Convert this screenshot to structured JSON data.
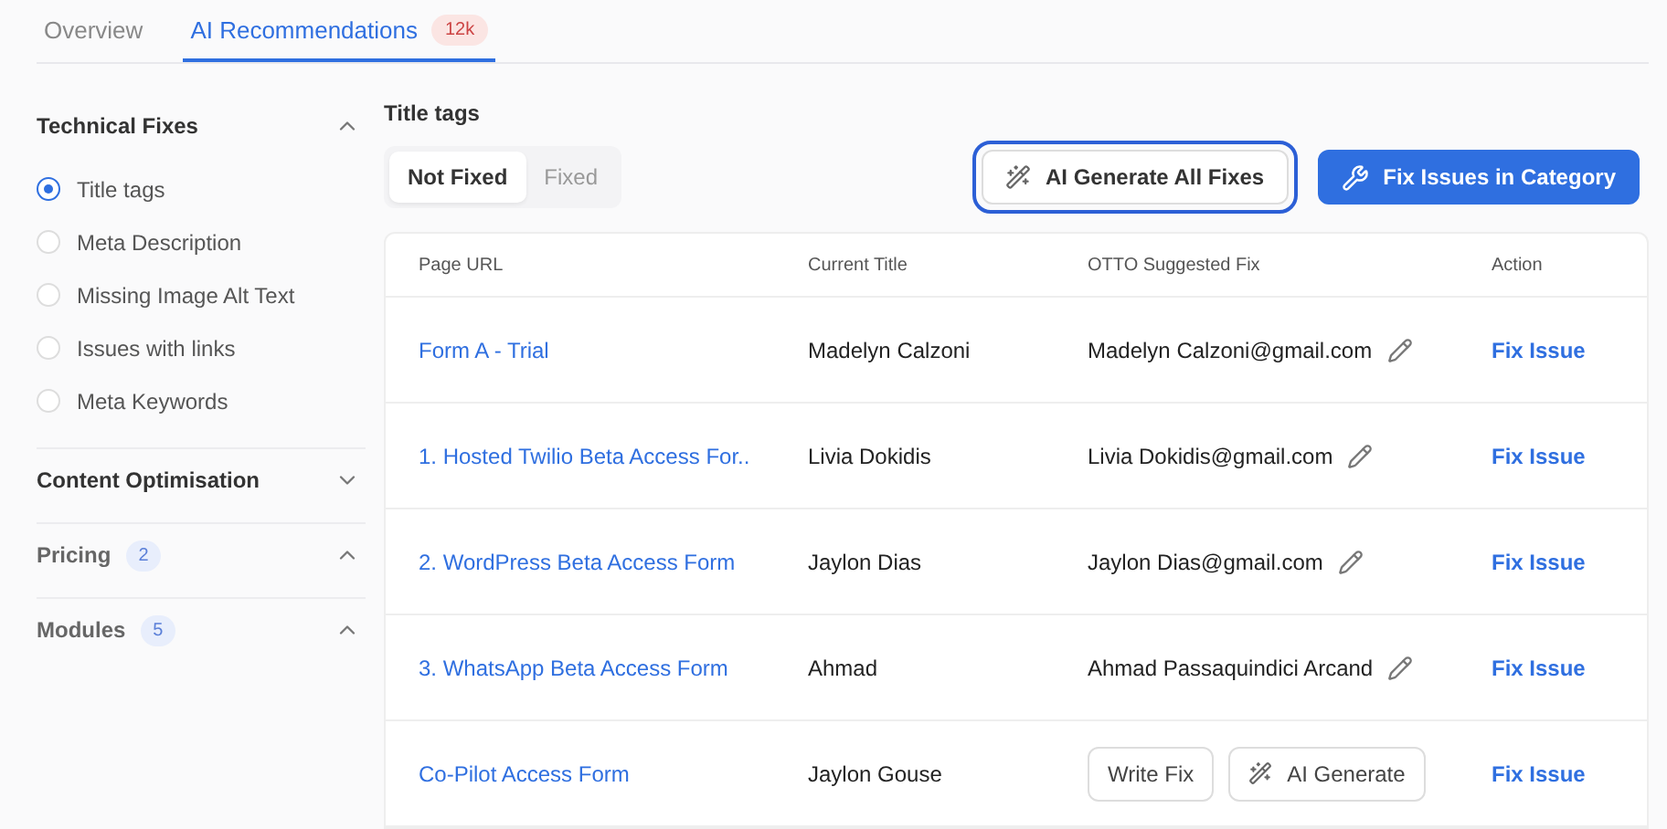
{
  "tabs": [
    {
      "label": "Overview",
      "selected": false
    },
    {
      "label": "AI Recommendations",
      "selected": true,
      "badge": "12k"
    }
  ],
  "sidebar": {
    "sections": [
      {
        "title": "Technical Fixes",
        "expanded": true,
        "items": [
          {
            "label": "Title tags",
            "selected": true
          },
          {
            "label": "Meta Description",
            "selected": false
          },
          {
            "label": "Missing Image Alt Text",
            "selected": false
          },
          {
            "label": "Issues with links",
            "selected": false
          },
          {
            "label": "Meta Keywords",
            "selected": false
          }
        ]
      },
      {
        "title": "Content Optimisation",
        "expanded": false
      },
      {
        "title": "Pricing",
        "count": "2",
        "expanded": true
      },
      {
        "title": "Modules",
        "count": "5",
        "expanded": true
      }
    ]
  },
  "main": {
    "title": "Title tags",
    "filters": [
      {
        "label": "Not Fixed",
        "selected": true
      },
      {
        "label": "Fixed",
        "selected": false
      }
    ],
    "actions": [
      {
        "label": "AI Generate All Fixes",
        "kind": "outline",
        "highlighted": true
      },
      {
        "label": "Fix Issues in Category",
        "kind": "primary",
        "highlighted": false
      }
    ],
    "table": {
      "columns": [
        "Page URL",
        "Current Title",
        "OTTO Suggested Fix",
        "Action"
      ],
      "rows": [
        {
          "url": "Form A - Trial",
          "title": "Madelyn Calzoni",
          "fix": {
            "kind": "text",
            "text": "Madelyn Calzoni@gmail.com"
          },
          "action": "Fix Issue"
        },
        {
          "url": "1. Hosted Twilio Beta Access For..",
          "title": "Livia Dokidis",
          "fix": {
            "kind": "text",
            "text": "Livia Dokidis@gmail.com"
          },
          "action": "Fix Issue"
        },
        {
          "url": "2. WordPress Beta Access Form",
          "title": "Jaylon Dias",
          "fix": {
            "kind": "text",
            "text": "Jaylon Dias@gmail.com"
          },
          "action": "Fix Issue"
        },
        {
          "url": "3. WhatsApp Beta Access Form",
          "title": "Ahmad",
          "fix": {
            "kind": "text",
            "text": "Ahmad Passaquindici Arcand"
          },
          "action": "Fix Issue"
        },
        {
          "url": "Co-Pilot Access Form",
          "title": "Jaylon Gouse",
          "fix": {
            "kind": "buttons",
            "buttons": [
              "Write Fix",
              "AI Generate"
            ]
          },
          "action": "Fix Issue"
        }
      ]
    }
  }
}
